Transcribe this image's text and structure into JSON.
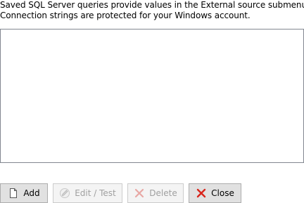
{
  "description": {
    "line1": "Saved SQL Server queries provide values in the External source submenu.",
    "line2": "Connection strings are protected for your Windows account."
  },
  "query_list": {
    "items": []
  },
  "buttons": {
    "add": {
      "label": "Add",
      "icon": "new-document-icon",
      "enabled": true
    },
    "edit_test": {
      "label": "Edit / Test",
      "icon": "edit-pencil-icon",
      "enabled": false
    },
    "delete": {
      "label": "Delete",
      "icon": "delete-x-icon",
      "enabled": false
    },
    "close": {
      "label": "Close",
      "icon": "close-x-icon",
      "enabled": true
    }
  },
  "colors": {
    "close_x": "#d9261c",
    "delete_x_disabled": "#e8a8a4",
    "list_border": "#828790"
  }
}
